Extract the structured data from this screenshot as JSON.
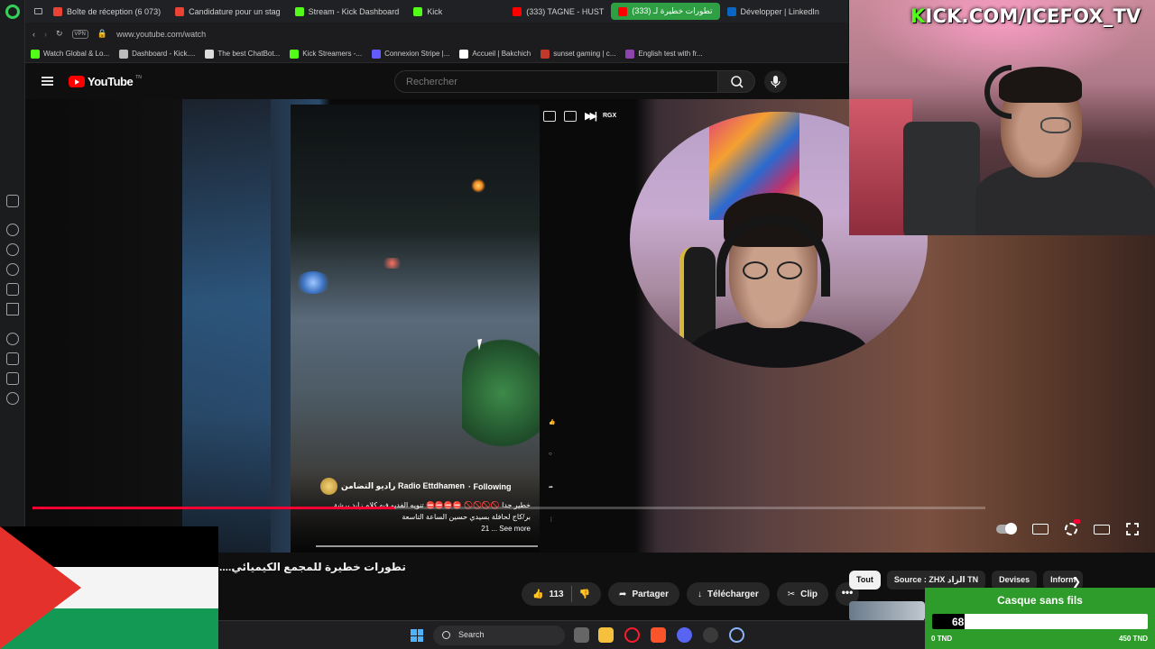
{
  "browser": {
    "tabs": [
      {
        "label": "Boîte de réception (6 073)",
        "color": "#ea4335"
      },
      {
        "label": "Candidature pour un stag",
        "color": "#ea4335"
      },
      {
        "label": "Stream - Kick Dashboard",
        "color": "#53fc18"
      },
      {
        "label": "Kick",
        "color": "#53fc18"
      },
      {
        "label": "(333) TAGNE - HUST",
        "color": "#ff0000"
      },
      {
        "label": "(333) تطورات خطيرة لـ",
        "color": "#ff0000"
      },
      {
        "label": "Développer | LinkedIn",
        "color": "#0a66c2"
      }
    ],
    "url": "www.youtube.com/watch",
    "vpn_label": "VPN",
    "bookmarks": [
      "Watch Global & Lo...",
      "Dashboard - Kick....",
      "The best ChatBot...",
      "Kick Streamers -...",
      "Connexion Stripe |...",
      "Accueil | Bakchich",
      "sunset gaming | c...",
      "English test with fr..."
    ]
  },
  "youtube": {
    "logo_text": "YouTube",
    "logo_region": "TN",
    "search_placeholder": "Rechercher",
    "pip_label": "RGX",
    "short": {
      "channel": "راديو التضامن Radio Ettdhamen",
      "following": "· Following",
      "desc_line1": "خطير جدا 🚫🚫🚫🚫 ⛔⛔⛔⛔ تنويه الفديو فيه كلام زايد برشة",
      "desc_line2": "بر/كاج لحافلة بسيدي حسين  الساعة التاسعة",
      "see_more": "21 ... See more"
    },
    "progress": 0.38,
    "video_title": "....تطورات خطيرة للمجمع الكيميائي",
    "actions": {
      "likes": "113",
      "share": "Partager",
      "download": "Télécharger",
      "clip": "Clip",
      "more": "•••"
    },
    "chips": [
      "Tout",
      "Source : ZHX الزاد TN",
      "Devises",
      "Inform"
    ]
  },
  "stream_overlay": {
    "kick_url": "KICK.COM/ICEFOX_TV",
    "goal": {
      "title": "Casque sans fils",
      "current": 68,
      "min_label": "0 TND",
      "max_label": "450 TND",
      "max": 450
    }
  },
  "taskbar": {
    "search_label": "Search"
  }
}
